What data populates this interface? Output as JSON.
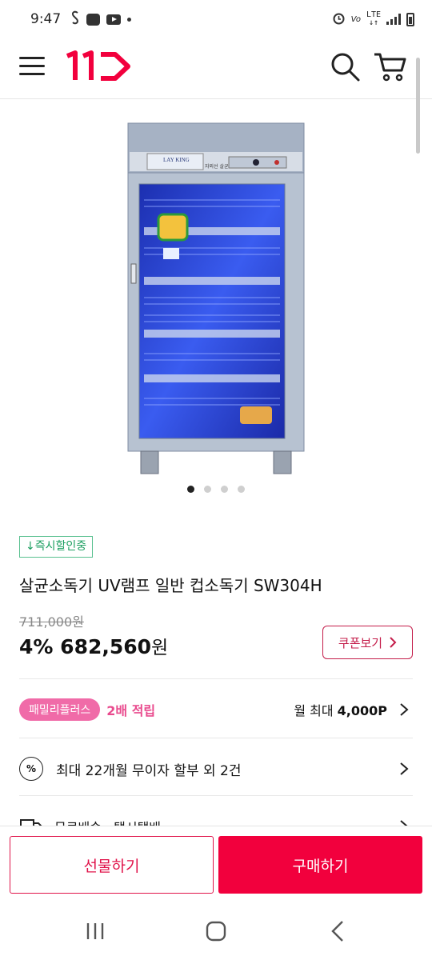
{
  "status_bar": {
    "time": "9:47",
    "network": "LTE",
    "icons": [
      "s-app-icon",
      "messenger-icon",
      "youtube-icon",
      "notification-dot-icon",
      "alarm-icon",
      "volte-icon",
      "lte-icon",
      "signal-icon",
      "battery-icon"
    ]
  },
  "header": {
    "logo_text": "11",
    "icons": [
      "menu-icon",
      "search-icon",
      "cart-icon"
    ]
  },
  "colors": {
    "brand": "#f2003d",
    "coupon": "#c41d4a",
    "instant_green": "#1a9e5f",
    "family_pink": "#f06ba8"
  },
  "product": {
    "image_labels": {
      "brand": "LAY KING",
      "panel": "자외선 살균기"
    },
    "image_count": 4,
    "active_image": 1,
    "instant_badge": "↓즉시할인중",
    "title": "살균소독기 UV램프 일반 컵소독기 SW304H",
    "original_price": "711,000원",
    "discount_rate": "4%",
    "sale_price": "682,560",
    "currency": "원",
    "coupon_button": "쿠폰보기"
  },
  "benefits": {
    "family_pill": "패밀리플러스",
    "family_double": "2배 적립",
    "monthly_prefix": "월 최대",
    "monthly_points": "4,000P",
    "installment_icon_text": "%",
    "installment": "최대 22개월 무이자 할부 외 2건",
    "delivery": "무료배송 · 택시택배"
  },
  "actions": {
    "gift": "선물하기",
    "buy": "구매하기"
  },
  "nav": {
    "icons": [
      "recent-apps-icon",
      "home-icon",
      "back-icon"
    ]
  }
}
